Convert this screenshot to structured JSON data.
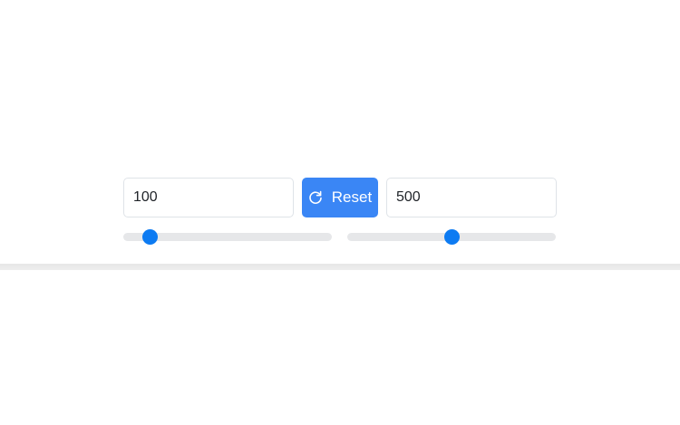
{
  "range": {
    "min_input": {
      "value": "100"
    },
    "max_input": {
      "value": "500"
    },
    "reset_button": {
      "label": "Reset",
      "icon": "refresh-icon"
    },
    "min_slider": {
      "value_fraction": 0.13
    },
    "max_slider": {
      "value_fraction": 0.5
    }
  },
  "colors": {
    "accent": "#3a86f5",
    "thumb": "#0d7bf2",
    "track": "#e6e7e9",
    "input_border": "#dfe3e8",
    "divider": "#e7e7e7"
  }
}
